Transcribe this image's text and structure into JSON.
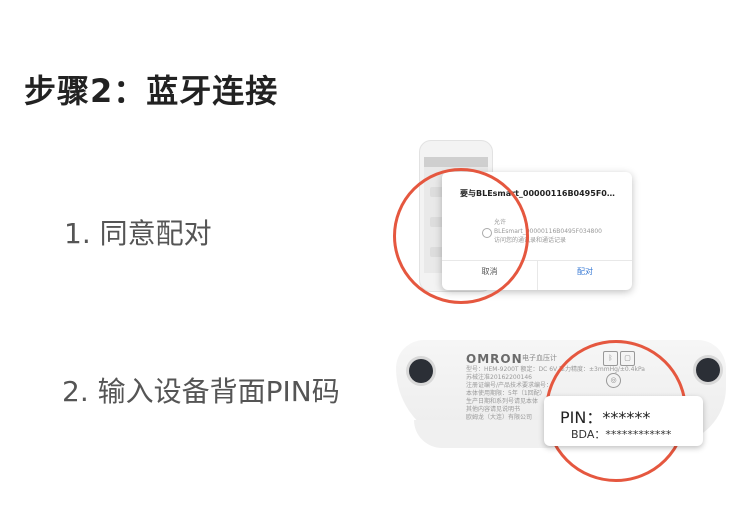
{
  "title": "步骤2：蓝牙连接",
  "steps": [
    {
      "label": "1. 同意配对"
    },
    {
      "label": "2. 输入设备背面PIN码"
    }
  ],
  "pair_dialog": {
    "title": "要与BLEsmart_00000116B0495F0…",
    "allow_lines": [
      "允许",
      "BLEsmart_00000116B0495F034800",
      "访问您的通讯录和通话记录"
    ],
    "cancel_label": "取消",
    "pair_label": "配对"
  },
  "device": {
    "brand": "OMRON",
    "brand_sub": "电子血压计",
    "label_lines": [
      "型号：HEM-9200T   额定：DC 6V   压力精度：±3mmHg/±0.4kPa",
      "苏械注准20162200146",
      "注册证编号/产品技术要求编号：",
      "本体使用期限：5年（1回配）",
      "生产日期和系列号请见本体",
      "其他内容请见说明书",
      "欧姆龙（大连）有限公司"
    ],
    "pin": "PIN：******",
    "bda": "BDA：************"
  },
  "accent_color": "#e5573f"
}
